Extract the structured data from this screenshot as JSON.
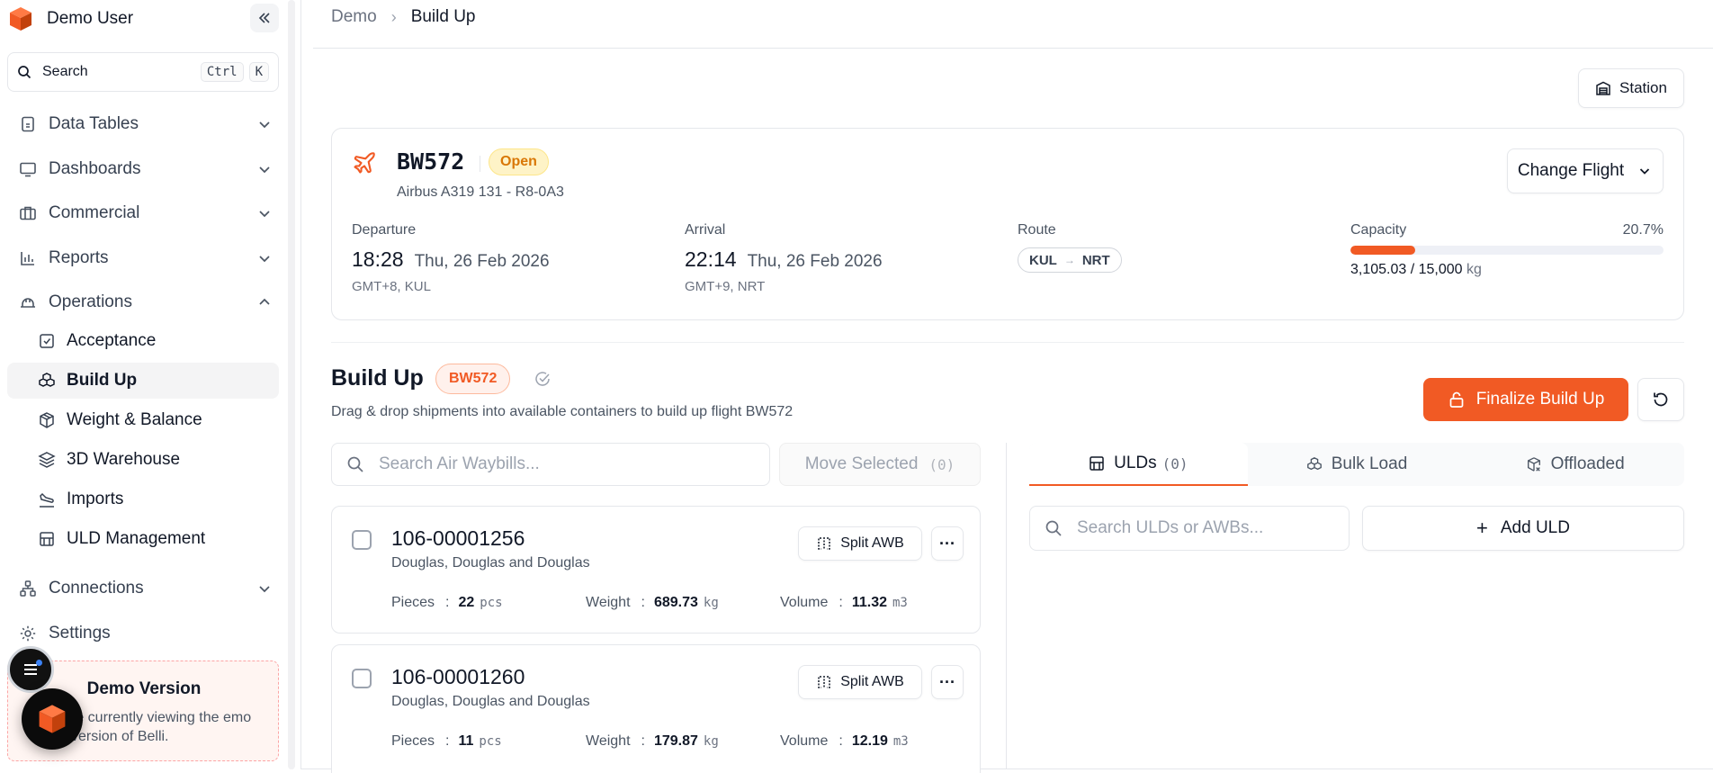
{
  "sidebar": {
    "user_name": "Demo User",
    "search": {
      "label": "Search",
      "kbd1": "Ctrl",
      "kbd2": "K"
    },
    "nav": {
      "data_tables": "Data Tables",
      "dashboards": "Dashboards",
      "commercial": "Commercial",
      "reports": "Reports",
      "operations": "Operations",
      "connections": "Connections",
      "settings": "Settings"
    },
    "operations_items": {
      "acceptance": "Acceptance",
      "build_up": "Build Up",
      "weight_balance": "Weight & Balance",
      "warehouse_3d": "3D Warehouse",
      "imports": "Imports",
      "uld_management": "ULD Management"
    },
    "demo": {
      "title": "Demo Version",
      "text": "re currently viewing the emo version of Belli."
    }
  },
  "breadcrumb": {
    "root": "Demo",
    "current": "Build Up"
  },
  "station_button": "Station",
  "flight": {
    "number": "BW572",
    "status": "Open",
    "aircraft": "Airbus A319 131 - R8-0A3",
    "change_flight_label": "Change Flight",
    "departure": {
      "label": "Departure",
      "time": "18:28",
      "date": "Thu, 26 Feb 2026",
      "tz": "GMT+8, KUL"
    },
    "arrival": {
      "label": "Arrival",
      "time": "22:14",
      "date": "Thu, 26 Feb 2026",
      "tz": "GMT+9, NRT"
    },
    "route": {
      "label": "Route",
      "from": "KUL",
      "to": "NRT"
    },
    "capacity": {
      "label": "Capacity",
      "percent_text": "20.7%",
      "fraction": 0.207,
      "used": "3,105.03",
      "total": "15,000",
      "unit": "kg"
    }
  },
  "build_up": {
    "title": "Build Up",
    "flight_badge": "BW572",
    "subtitle": "Drag & drop shipments into available containers to build up flight BW572",
    "finalize_label": "Finalize Build Up",
    "search_placeholder": "Search Air Waybills...",
    "move_selected_label": "Move Selected",
    "move_selected_count": "(0)"
  },
  "awbs": [
    {
      "number": "106-00001256",
      "customer": "Douglas, Douglas and Douglas",
      "split_label": "Split AWB",
      "pieces_label": "Pieces",
      "pieces": "22",
      "pieces_unit": "pcs",
      "weight_label": "Weight",
      "weight": "689.73",
      "weight_unit": "kg",
      "volume_label": "Volume",
      "volume": "11.32",
      "volume_unit": "m3"
    },
    {
      "number": "106-00001260",
      "customer": "Douglas, Douglas and Douglas",
      "split_label": "Split AWB",
      "pieces_label": "Pieces",
      "pieces": "11",
      "pieces_unit": "pcs",
      "weight_label": "Weight",
      "weight": "179.87",
      "weight_unit": "kg",
      "volume_label": "Volume",
      "volume": "12.19",
      "volume_unit": "m3"
    }
  ],
  "uld_panel": {
    "tabs": {
      "ulds": "ULDs",
      "ulds_count": "(0)",
      "bulk": "Bulk Load",
      "offloaded": "Offloaded"
    },
    "search_placeholder": "Search ULDs or AWBs...",
    "add_label": "Add ULD"
  },
  "colors": {
    "accent": "#f15a24",
    "badge_open_bg": "#fef3c7",
    "badge_open_text": "#d97706"
  }
}
